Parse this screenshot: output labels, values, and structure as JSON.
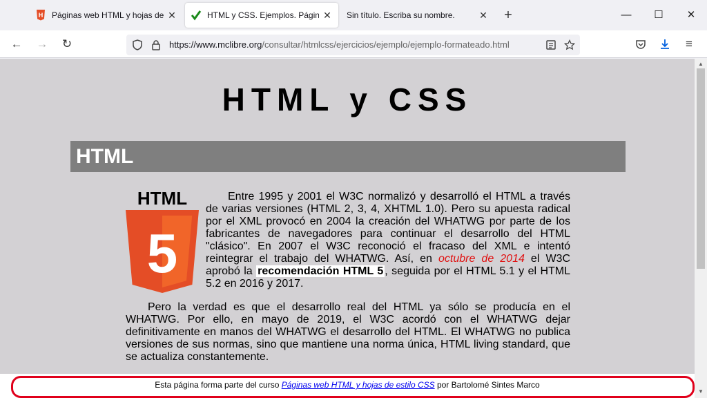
{
  "browser": {
    "tabs": [
      {
        "title": "Páginas web HTML y hojas de estilo CSS",
        "active": false
      },
      {
        "title": "HTML y CSS. Ejemplos. Páginas web HTML",
        "active": true
      },
      {
        "title": "Sin título. Escriba su nombre.",
        "active": false
      }
    ],
    "new_tab": "+",
    "url_domain": "https://www.mclibre.org",
    "url_path": "/consultar/htmlcss/ejercicios/ejemplo/ejemplo-formateado.html"
  },
  "page": {
    "title": "HTML y CSS",
    "section_heading": "HTML",
    "logo_text": "HTML",
    "logo_digit": "5",
    "para1_a": "Entre 1995 y 2001 el W3C normalizó y desarrolló el HTML a través de varias versiones (HTML 2, 3, 4, XHTML 1.0). Pero su apuesta radical por el XML provocó en 2004 la creación del WHATWG por parte de los fabricantes de navegadores para continuar el desarrollo del HTML \"clásico\". En 2007 el W3C reconoció el fracaso del XML e intentó reintegrar el trabajo del WHATWG. Así, en ",
    "para1_red": "octubre de 2014",
    "para1_b": " el W3C aprobó la ",
    "para1_bold": "recomendación HTML 5",
    "para1_c": ", seguida por el HTML 5.1 y el HTML 5.2 en 2016 y 2017.",
    "para2": "Pero la verdad es que el desarrollo real del HTML ya sólo se producía en el WHATWG. Por ello, en mayo de 2019, el W3C acordó con el WHATWG dejar definitivamente en manos del WHATWG el desarrollo del HTML. El WHATWG no publica versiones de sus normas, sino que mantiene una norma única, HTML living standard, que se actualiza constantemente."
  },
  "footer": {
    "prefix": "Esta página forma parte del curso ",
    "link": "Páginas web HTML y hojas de estilo CSS",
    "suffix": " por Bartolomé Sintes Marco"
  },
  "colors": {
    "page_bg": "#d3d1d4",
    "section_bg": "#7f7f7f",
    "html5_orange": "#e44d26",
    "footer_border": "#e0001b"
  }
}
